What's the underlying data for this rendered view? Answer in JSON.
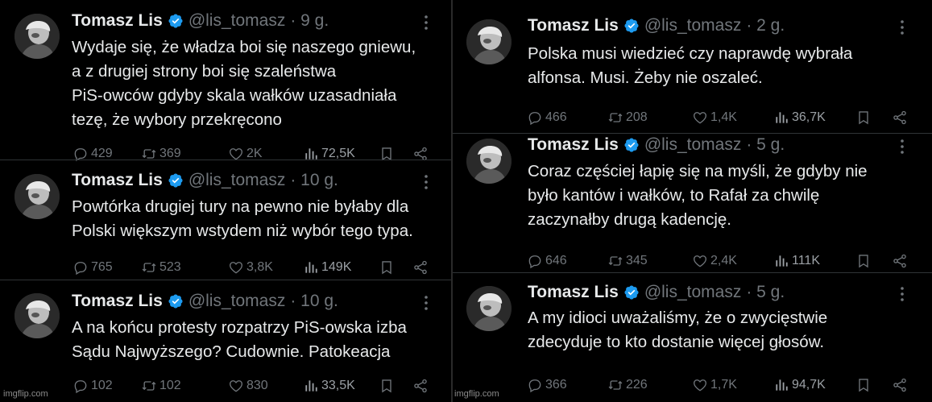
{
  "colors": {
    "background": "#000000",
    "text": "#e7e9ea",
    "muted": "#71767b",
    "verified": "#1d9bf0",
    "separator": "#2f3336"
  },
  "icons": {
    "verified": "verified-badge-icon",
    "reply": "reply-icon",
    "retweet": "retweet-icon",
    "like": "heart-icon",
    "views": "views-chart-icon",
    "bookmark": "bookmark-icon",
    "share": "share-icon",
    "more": "more-dots-icon"
  },
  "left": {
    "tweets": [
      {
        "name": "Tomasz Lis",
        "handle": "@lis_tomasz",
        "time": "· 9 g.",
        "lines": [
          "Wydaje się, że władza boi się naszego gniewu,",
          "a z drugiej strony boi się szaleństwa",
          "PiS-owców gdyby skala wałków uzasadniała",
          "tezę, że wybory przekręcono"
        ],
        "replies": "429",
        "retweets": "369",
        "likes": "2K",
        "views": "72,5K"
      },
      {
        "name": "Tomasz Lis",
        "handle": "@lis_tomasz",
        "time": "· 10 g.",
        "lines": [
          "Powtórka drugiej tury na pewno nie byłaby dla",
          "Polski większym wstydem niż wybór tego typa."
        ],
        "replies": "765",
        "retweets": "523",
        "likes": "3,8K",
        "views": "149K"
      },
      {
        "name": "Tomasz Lis",
        "handle": "@lis_tomasz",
        "time": "· 10 g.",
        "lines": [
          "A na końcu protesty rozpatrzy PiS-owska izba",
          "Sądu Najwyższego? Cudownie. Patokeacja"
        ],
        "replies": "102",
        "retweets": "102",
        "likes": "830",
        "views": "33,5K"
      }
    ],
    "watermark": "imgflip.com"
  },
  "right": {
    "tweets": [
      {
        "name": "Tomasz Lis",
        "handle": "@lis_tomasz",
        "time": "· 2 g.",
        "lines": [
          "Polska musi wiedzieć czy naprawdę wybrała",
          "alfonsa. Musi. Żeby nie oszaleć."
        ],
        "replies": "466",
        "retweets": "208",
        "likes": "1,4K",
        "views": "36,7K"
      },
      {
        "name": "Tomasz Lis",
        "handle": "@lis_tomasz",
        "time": "· 5 g.",
        "lines": [
          "Coraz częściej łapię się na myśli, że gdyby nie",
          "było kantów i wałków, to Rafał za chwilę",
          "zaczynałby drugą kadencję."
        ],
        "replies": "646",
        "retweets": "345",
        "likes": "2,4K",
        "views": "111K"
      },
      {
        "name": "Tomasz Lis",
        "handle": "@lis_tomasz",
        "time": "· 5 g.",
        "lines": [
          "A my idioci uważaliśmy, że o zwycięstwie",
          "zdecyduje to kto dostanie więcej głosów."
        ],
        "replies": "366",
        "retweets": "226",
        "likes": "1,7K",
        "views": "94,7K"
      }
    ],
    "watermark": "imgflip.com"
  }
}
